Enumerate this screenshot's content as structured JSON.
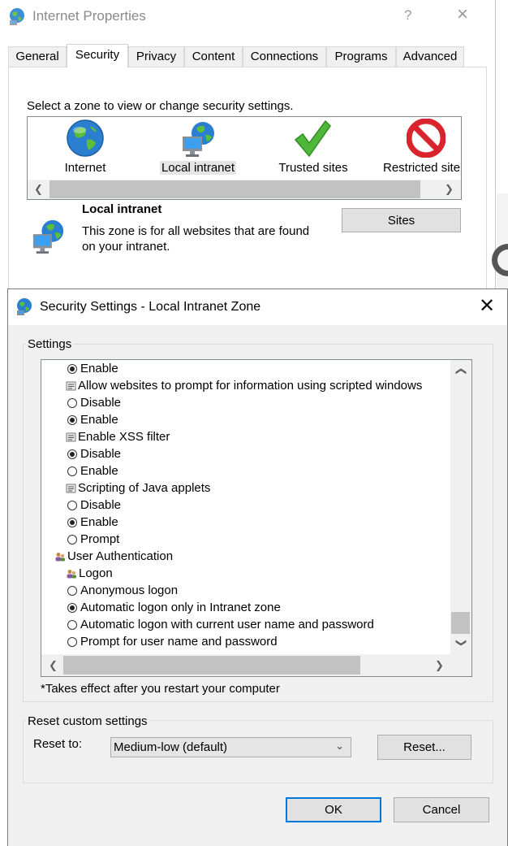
{
  "internet_properties": {
    "title": "Internet Properties",
    "help": "?",
    "close": "×",
    "tabs": [
      "General",
      "Security",
      "Privacy",
      "Content",
      "Connections",
      "Programs",
      "Advanced"
    ],
    "active_tab": "Security",
    "zone_prompt": "Select a zone to view or change security settings.",
    "zones": [
      {
        "label": "Internet",
        "icon": "globe-icon"
      },
      {
        "label": "Local intranet",
        "icon": "intranet-icon"
      },
      {
        "label": "Trusted sites",
        "icon": "checkmark-icon"
      },
      {
        "label": "Restricted site",
        "icon": "restricted-icon"
      }
    ],
    "selected_zone": "Local intranet",
    "zone_info_title": "Local intranet",
    "zone_info_desc": "This zone is for all websites that are found on your intranet.",
    "sites_button": "Sites"
  },
  "security_settings": {
    "title": "Security Settings - Local Intranet Zone",
    "close": "✕",
    "settings_group_label": "Settings",
    "tree": [
      {
        "type": "option",
        "label": "Enable",
        "checked": true,
        "indent": 1
      },
      {
        "type": "setting",
        "label": "Allow websites to prompt for information using scripted windows",
        "indent": 1
      },
      {
        "type": "option",
        "label": "Disable",
        "checked": false,
        "indent": 1
      },
      {
        "type": "option",
        "label": "Enable",
        "checked": true,
        "indent": 1
      },
      {
        "type": "setting",
        "label": "Enable XSS filter",
        "indent": 1
      },
      {
        "type": "option",
        "label": "Disable",
        "checked": true,
        "indent": 1
      },
      {
        "type": "option",
        "label": "Enable",
        "checked": false,
        "indent": 1
      },
      {
        "type": "setting",
        "label": "Scripting of Java applets",
        "indent": 1
      },
      {
        "type": "option",
        "label": "Disable",
        "checked": false,
        "indent": 1
      },
      {
        "type": "option",
        "label": "Enable",
        "checked": true,
        "indent": 1
      },
      {
        "type": "option",
        "label": "Prompt",
        "checked": false,
        "indent": 1
      },
      {
        "type": "category",
        "label": "User Authentication",
        "indent": 0
      },
      {
        "type": "category",
        "label": "Logon",
        "indent": 1
      },
      {
        "type": "option",
        "label": "Anonymous logon",
        "checked": false,
        "indent": 1
      },
      {
        "type": "option",
        "label": "Automatic logon only in Intranet zone",
        "checked": true,
        "indent": 1
      },
      {
        "type": "option",
        "label": "Automatic logon with current user name and password",
        "checked": false,
        "indent": 1
      },
      {
        "type": "option",
        "label": "Prompt for user name and password",
        "checked": false,
        "indent": 1
      }
    ],
    "restart_note": "*Takes effect after you restart your computer",
    "reset_group_label": "Reset custom settings",
    "reset_to_label": "Reset to:",
    "reset_to_value": "Medium-low (default)",
    "reset_button": "Reset...",
    "ok_button": "OK",
    "cancel_button": "Cancel"
  },
  "colors": {
    "accent": "#0078d7",
    "dialog_bg": "#f0f0f0",
    "scroll_thumb": "#c2c2c2"
  }
}
